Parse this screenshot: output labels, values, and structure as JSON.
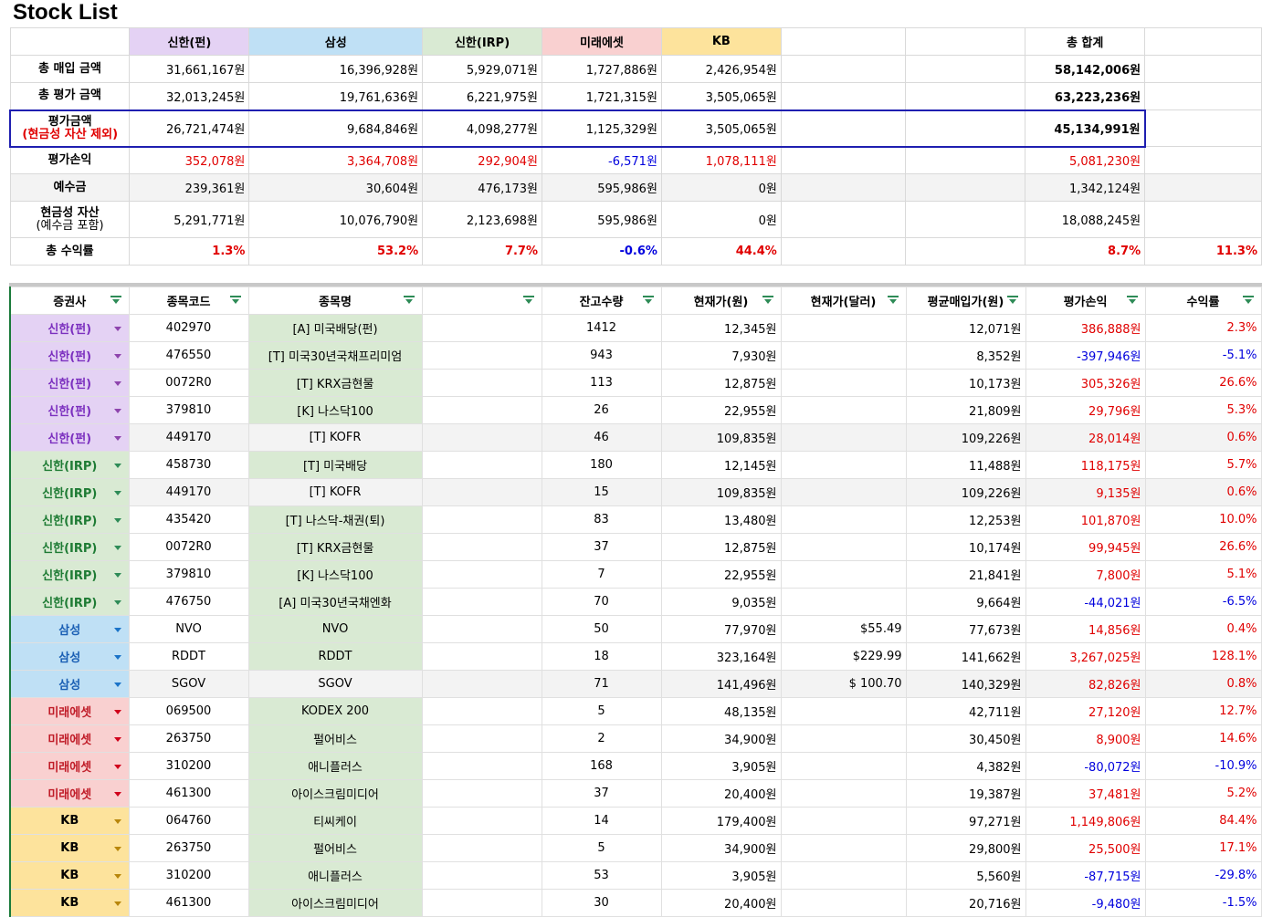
{
  "title": "Stock List",
  "colors": {
    "shinhan_fund": "#e4d2f4",
    "samsung": "#bfe0f5",
    "shinhan_irp": "#d9ead3",
    "mirae": "#f9d0d0",
    "kb": "#fde39c",
    "red": "#e00000",
    "blue": "#0000dd",
    "highlight_border": "#1f1fb0",
    "filter_icon": "#2e8b57"
  },
  "summary": {
    "headers": [
      "신한(펀)",
      "삼성",
      "신한(IRP)",
      "미래에셋",
      "KB",
      "",
      "",
      "총 합계",
      ""
    ],
    "rows": [
      {
        "label": "총 매입 금액",
        "values": [
          "31,661,167원",
          "16,396,928원",
          "5,929,071원",
          "1,727,886원",
          "2,426,954원",
          "",
          "",
          "58,142,006원",
          ""
        ]
      },
      {
        "label": "총 평가 금액",
        "values": [
          "32,013,245원",
          "19,761,636원",
          "6,221,975원",
          "1,721,315원",
          "3,505,065원",
          "",
          "",
          "63,223,236원",
          ""
        ]
      },
      {
        "label": "평가금액",
        "label_sub": "(현금성 자산 제외)",
        "values": [
          "26,721,474원",
          "9,684,846원",
          "4,098,277원",
          "1,125,329원",
          "3,505,065원",
          "",
          "",
          "45,134,991원",
          ""
        ]
      },
      {
        "label": "평가손익",
        "values": [
          "352,078원",
          "3,364,708원",
          "292,904원",
          "-6,571원",
          "1,078,111원",
          "",
          "",
          "5,081,230원",
          ""
        ]
      },
      {
        "label": "예수금",
        "values": [
          "239,361원",
          "30,604원",
          "476,173원",
          "595,986원",
          "0원",
          "",
          "",
          "1,342,124원",
          ""
        ]
      },
      {
        "label": "현금성 자산",
        "label_sub": "(예수금 포함)",
        "values": [
          "5,291,771원",
          "10,076,790원",
          "2,123,698원",
          "595,986원",
          "0원",
          "",
          "",
          "18,088,245원",
          ""
        ]
      },
      {
        "label": "총 수익률",
        "values": [
          "1.3%",
          "53.2%",
          "7.7%",
          "-0.6%",
          "44.4%",
          "",
          "",
          "8.7%",
          "11.3%"
        ]
      }
    ]
  },
  "detail": {
    "headers": [
      "증권사",
      "종목코드",
      "종목명",
      "",
      "잔고수량",
      "현재가(원)",
      "현재가(달러)",
      "평균매입가(원)",
      "평가손익",
      "수익률"
    ],
    "rows": [
      {
        "broker": "신한(펀)",
        "code": "402970",
        "name": "[A] 미국배당(펀)",
        "qty": "1412",
        "price": "12,345원",
        "usd": "",
        "avg": "12,071원",
        "pl": "386,888원",
        "ret": "2.3%"
      },
      {
        "broker": "신한(펀)",
        "code": "476550",
        "name": "[T] 미국30년국채프리미엄",
        "qty": "943",
        "price": "7,930원",
        "usd": "",
        "avg": "8,352원",
        "pl": "-397,946원",
        "ret": "-5.1%"
      },
      {
        "broker": "신한(펀)",
        "code": "0072R0",
        "name": "[T] KRX금현물",
        "qty": "113",
        "price": "12,875원",
        "usd": "",
        "avg": "10,173원",
        "pl": "305,326원",
        "ret": "26.6%"
      },
      {
        "broker": "신한(펀)",
        "code": "379810",
        "name": "[K] 나스닥100",
        "qty": "26",
        "price": "22,955원",
        "usd": "",
        "avg": "21,809원",
        "pl": "29,796원",
        "ret": "5.3%"
      },
      {
        "broker": "신한(펀)",
        "code": "449170",
        "name": "[T] KOFR",
        "qty": "46",
        "price": "109,835원",
        "usd": "",
        "avg": "109,226원",
        "pl": "28,014원",
        "ret": "0.6%"
      },
      {
        "broker": "신한(IRP)",
        "code": "458730",
        "name": "[T] 미국배당",
        "qty": "180",
        "price": "12,145원",
        "usd": "",
        "avg": "11,488원",
        "pl": "118,175원",
        "ret": "5.7%"
      },
      {
        "broker": "신한(IRP)",
        "code": "449170",
        "name": "[T] KOFR",
        "qty": "15",
        "price": "109,835원",
        "usd": "",
        "avg": "109,226원",
        "pl": "9,135원",
        "ret": "0.6%"
      },
      {
        "broker": "신한(IRP)",
        "code": "435420",
        "name": "[T] 나스닥-채권(퇴)",
        "qty": "83",
        "price": "13,480원",
        "usd": "",
        "avg": "12,253원",
        "pl": "101,870원",
        "ret": "10.0%"
      },
      {
        "broker": "신한(IRP)",
        "code": "0072R0",
        "name": "[T] KRX금현물",
        "qty": "37",
        "price": "12,875원",
        "usd": "",
        "avg": "10,174원",
        "pl": "99,945원",
        "ret": "26.6%"
      },
      {
        "broker": "신한(IRP)",
        "code": "379810",
        "name": "[K] 나스닥100",
        "qty": "7",
        "price": "22,955원",
        "usd": "",
        "avg": "21,841원",
        "pl": "7,800원",
        "ret": "5.1%"
      },
      {
        "broker": "신한(IRP)",
        "code": "476750",
        "name": "[A] 미국30년국채엔화",
        "qty": "70",
        "price": "9,035원",
        "usd": "",
        "avg": "9,664원",
        "pl": "-44,021원",
        "ret": "-6.5%"
      },
      {
        "broker": "삼성",
        "code": "NVO",
        "name": "NVO",
        "qty": "50",
        "price": "77,970원",
        "usd": "$55.49",
        "avg": "77,673원",
        "pl": "14,856원",
        "ret": "0.4%"
      },
      {
        "broker": "삼성",
        "code": "RDDT",
        "name": "RDDT",
        "qty": "18",
        "price": "323,164원",
        "usd": "$229.99",
        "avg": "141,662원",
        "pl": "3,267,025원",
        "ret": "128.1%"
      },
      {
        "broker": "삼성",
        "code": "SGOV",
        "name": "SGOV",
        "qty": "71",
        "price": "141,496원",
        "usd": "$ 100.70",
        "avg": "140,329원",
        "pl": "82,826원",
        "ret": "0.8%"
      },
      {
        "broker": "미래에셋",
        "code": "069500",
        "name": "KODEX 200",
        "qty": "5",
        "price": "48,135원",
        "usd": "",
        "avg": "42,711원",
        "pl": "27,120원",
        "ret": "12.7%"
      },
      {
        "broker": "미래에셋",
        "code": "263750",
        "name": "펄어비스",
        "qty": "2",
        "price": "34,900원",
        "usd": "",
        "avg": "30,450원",
        "pl": "8,900원",
        "ret": "14.6%"
      },
      {
        "broker": "미래에셋",
        "code": "310200",
        "name": "애니플러스",
        "qty": "168",
        "price": "3,905원",
        "usd": "",
        "avg": "4,382원",
        "pl": "-80,072원",
        "ret": "-10.9%"
      },
      {
        "broker": "미래에셋",
        "code": "461300",
        "name": "아이스크림미디어",
        "qty": "37",
        "price": "20,400원",
        "usd": "",
        "avg": "19,387원",
        "pl": "37,481원",
        "ret": "5.2%"
      },
      {
        "broker": "KB",
        "code": "064760",
        "name": "티씨케이",
        "qty": "14",
        "price": "179,400원",
        "usd": "",
        "avg": "97,271원",
        "pl": "1,149,806원",
        "ret": "84.4%"
      },
      {
        "broker": "KB",
        "code": "263750",
        "name": "펄어비스",
        "qty": "5",
        "price": "34,900원",
        "usd": "",
        "avg": "29,800원",
        "pl": "25,500원",
        "ret": "17.1%"
      },
      {
        "broker": "KB",
        "code": "310200",
        "name": "애니플러스",
        "qty": "53",
        "price": "3,905원",
        "usd": "",
        "avg": "5,560원",
        "pl": "-87,715원",
        "ret": "-29.8%"
      },
      {
        "broker": "KB",
        "code": "461300",
        "name": "아이스크림미디어",
        "qty": "30",
        "price": "20,400원",
        "usd": "",
        "avg": "20,716원",
        "pl": "-9,480원",
        "ret": "-1.5%"
      }
    ]
  }
}
